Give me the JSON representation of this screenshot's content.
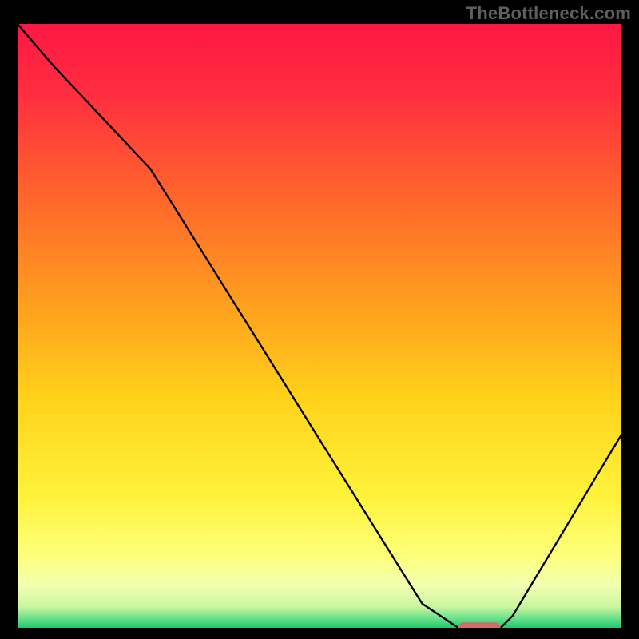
{
  "watermark": "TheBottleneck.com",
  "chart_data": {
    "type": "line",
    "title": "",
    "xlabel": "",
    "ylabel": "",
    "xlim": [
      0,
      100
    ],
    "ylim": [
      0,
      100
    ],
    "grid": false,
    "legend": false,
    "series": [
      {
        "name": "curve",
        "x": [
          0,
          6,
          22,
          67,
          73,
          80,
          82,
          100
        ],
        "y": [
          100,
          93,
          76,
          4,
          0,
          0,
          2,
          32
        ],
        "color": "#000000",
        "width": 2
      }
    ],
    "marker": {
      "x_start": 73,
      "x_end": 80,
      "y": 0,
      "thickness": 1.8,
      "color": "#d46a6a"
    },
    "gradient_stops": [
      {
        "offset": 0.0,
        "color": "#ff1744"
      },
      {
        "offset": 0.12,
        "color": "#ff2f3f"
      },
      {
        "offset": 0.3,
        "color": "#ff6a2a"
      },
      {
        "offset": 0.48,
        "color": "#ffa41e"
      },
      {
        "offset": 0.62,
        "color": "#ffd21a"
      },
      {
        "offset": 0.78,
        "color": "#fff23a"
      },
      {
        "offset": 0.88,
        "color": "#fdff7a"
      },
      {
        "offset": 0.93,
        "color": "#f2ffb0"
      },
      {
        "offset": 0.965,
        "color": "#c8f7a0"
      },
      {
        "offset": 0.985,
        "color": "#66e08a"
      },
      {
        "offset": 1.0,
        "color": "#1ec96f"
      }
    ]
  }
}
